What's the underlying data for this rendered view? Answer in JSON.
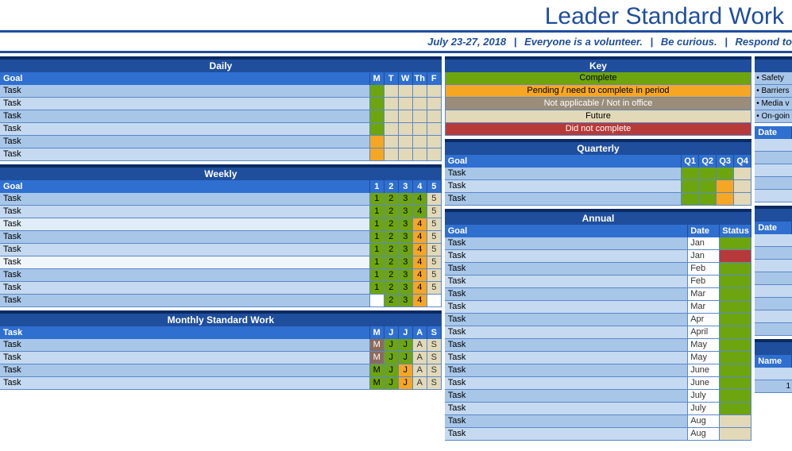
{
  "title": "Leader Standard Work",
  "subtitle": {
    "date": "July 23-27, 2018",
    "msg1": "Everyone is a volunteer.",
    "msg2": "Be curious.",
    "msg3": "Respond to"
  },
  "daily": {
    "title": "Daily",
    "goal_label": "Goal",
    "cols": [
      "M",
      "T",
      "W",
      "Th",
      "F"
    ],
    "rows": [
      {
        "label": "Task",
        "cells": [
          "c-green",
          "c-tan",
          "c-tan",
          "c-tan",
          "c-tan"
        ]
      },
      {
        "label": "Task",
        "cells": [
          "c-green",
          "c-tan",
          "c-tan",
          "c-tan",
          "c-tan"
        ]
      },
      {
        "label": "Task",
        "cells": [
          "c-green",
          "c-tan",
          "c-tan",
          "c-tan",
          "c-tan"
        ]
      },
      {
        "label": "Task",
        "cells": [
          "c-green",
          "c-tan",
          "c-tan",
          "c-tan",
          "c-tan"
        ]
      },
      {
        "label": "Task",
        "cells": [
          "c-orange",
          "c-tan",
          "c-tan",
          "c-tan",
          "c-tan"
        ]
      },
      {
        "label": "Task",
        "cells": [
          "c-orange",
          "c-tan",
          "c-tan",
          "c-tan",
          "c-tan"
        ]
      }
    ]
  },
  "weekly": {
    "title": "Weekly",
    "goal_label": "Goal",
    "cols": [
      "1",
      "2",
      "3",
      "4",
      "5"
    ],
    "rows": [
      {
        "label": "Task",
        "bg": "lbl",
        "cells": [
          [
            "1",
            "c-green"
          ],
          [
            "2",
            "c-green"
          ],
          [
            "3",
            "c-green"
          ],
          [
            "4",
            "c-green"
          ],
          [
            "5",
            "c-tan"
          ]
        ]
      },
      {
        "label": "Task",
        "bg": "lbl alt",
        "cells": [
          [
            "1",
            "c-green"
          ],
          [
            "2",
            "c-green"
          ],
          [
            "3",
            "c-green"
          ],
          [
            "4",
            "c-green"
          ],
          [
            "5",
            "c-tan"
          ]
        ]
      },
      {
        "label": "Task",
        "bg": "lbl lt",
        "cells": [
          [
            "1",
            "c-green"
          ],
          [
            "2",
            "c-green"
          ],
          [
            "3",
            "c-green"
          ],
          [
            "4",
            "c-orange"
          ],
          [
            "5",
            "c-tan"
          ]
        ]
      },
      {
        "label": "Task",
        "bg": "lbl",
        "cells": [
          [
            "1",
            "c-green"
          ],
          [
            "2",
            "c-green"
          ],
          [
            "3",
            "c-green"
          ],
          [
            "4",
            "c-orange"
          ],
          [
            "5",
            "c-tan"
          ]
        ]
      },
      {
        "label": "Task",
        "bg": "lbl alt",
        "cells": [
          [
            "1",
            "c-green"
          ],
          [
            "2",
            "c-green"
          ],
          [
            "3",
            "c-green"
          ],
          [
            "4",
            "c-orange"
          ],
          [
            "5",
            "c-tan"
          ]
        ]
      },
      {
        "label": "Task",
        "bg": "lbl vlt",
        "cells": [
          [
            "1",
            "c-green"
          ],
          [
            "2",
            "c-green"
          ],
          [
            "3",
            "c-green"
          ],
          [
            "4",
            "c-orange"
          ],
          [
            "5",
            "c-tan"
          ]
        ]
      },
      {
        "label": "Task",
        "bg": "lbl",
        "cells": [
          [
            "1",
            "c-green"
          ],
          [
            "2",
            "c-green"
          ],
          [
            "3",
            "c-green"
          ],
          [
            "4",
            "c-orange"
          ],
          [
            "5",
            "c-tan"
          ]
        ]
      },
      {
        "label": "Task",
        "bg": "lbl alt",
        "cells": [
          [
            "1",
            "c-green"
          ],
          [
            "2",
            "c-green"
          ],
          [
            "3",
            "c-green"
          ],
          [
            "4",
            "c-orange"
          ],
          [
            "5",
            "c-tan"
          ]
        ]
      },
      {
        "label": "Task",
        "bg": "lbl",
        "cells": [
          [
            "",
            "c-white"
          ],
          [
            "2",
            "c-green"
          ],
          [
            "3",
            "c-green"
          ],
          [
            "4",
            "c-orange"
          ],
          [
            "",
            "c-white"
          ]
        ]
      }
    ]
  },
  "monthly": {
    "title": "Monthly Standard Work",
    "task_label": "Task",
    "cols": [
      "M",
      "J",
      "J",
      "A",
      "S"
    ],
    "rows": [
      {
        "label": "Task",
        "cells": [
          [
            "M",
            "c-brown"
          ],
          [
            "J",
            "c-green"
          ],
          [
            "J",
            "c-green"
          ],
          [
            "A",
            "c-tan"
          ],
          [
            "S",
            "c-tan"
          ]
        ]
      },
      {
        "label": "Task",
        "cells": [
          [
            "M",
            "c-brown"
          ],
          [
            "J",
            "c-green"
          ],
          [
            "J",
            "c-green"
          ],
          [
            "A",
            "c-tan"
          ],
          [
            "S",
            "c-tan"
          ]
        ]
      },
      {
        "label": "Task",
        "cells": [
          [
            "M",
            "c-green"
          ],
          [
            "J",
            "c-green"
          ],
          [
            "J",
            "c-orange"
          ],
          [
            "A",
            "c-tan"
          ],
          [
            "S",
            "c-tan"
          ]
        ]
      },
      {
        "label": "Task",
        "cells": [
          [
            "M",
            "c-green"
          ],
          [
            "J",
            "c-green"
          ],
          [
            "J",
            "c-orange"
          ],
          [
            "A",
            "c-tan"
          ],
          [
            "S",
            "c-tan"
          ]
        ]
      }
    ]
  },
  "key": {
    "title": "Key",
    "items": [
      {
        "label": "Complete",
        "class": "c-green"
      },
      {
        "label": "Pending / need to complete in period",
        "class": "c-orange"
      },
      {
        "label": "Not applicable / Not in office",
        "class": "c-grey"
      },
      {
        "label": "Future",
        "class": "c-tan"
      },
      {
        "label": "Did not complete",
        "class": "c-red"
      }
    ]
  },
  "quarterly": {
    "title": "Quarterly",
    "goal_label": "Goal",
    "cols": [
      "Q1",
      "Q2",
      "Q3",
      "Q4"
    ],
    "rows": [
      {
        "label": "Task",
        "cells": [
          "c-green",
          "c-green",
          "c-green",
          "c-tan"
        ]
      },
      {
        "label": "Task",
        "cells": [
          "c-green",
          "c-green",
          "c-orange",
          "c-tan"
        ]
      },
      {
        "label": "Task",
        "cells": [
          "c-green",
          "c-green",
          "c-orange",
          "c-tan"
        ]
      }
    ]
  },
  "annual": {
    "title": "Annual",
    "goal_label": "Goal",
    "date_label": "Date",
    "status_label": "Status",
    "rows": [
      {
        "label": "Task",
        "date": "Jan",
        "status": "c-green"
      },
      {
        "label": "Task",
        "date": "Jan",
        "status": "c-red"
      },
      {
        "label": "Task",
        "date": "Feb",
        "status": "c-green"
      },
      {
        "label": "Task",
        "date": "Feb",
        "status": "c-green"
      },
      {
        "label": "Task",
        "date": "Mar",
        "status": "c-green"
      },
      {
        "label": "Task",
        "date": "Mar",
        "status": "c-green"
      },
      {
        "label": "Task",
        "date": "Apr",
        "status": "c-green"
      },
      {
        "label": "Task",
        "date": "April",
        "status": "c-green"
      },
      {
        "label": "Task",
        "date": "May",
        "status": "c-green"
      },
      {
        "label": "Task",
        "date": "May",
        "status": "c-green"
      },
      {
        "label": "Task",
        "date": "June",
        "status": "c-green"
      },
      {
        "label": "Task",
        "date": "June",
        "status": "c-green"
      },
      {
        "label": "Task",
        "date": "July",
        "status": "c-green"
      },
      {
        "label": "Task",
        "date": "July",
        "status": "c-green"
      },
      {
        "label": "Task",
        "date": "Aug",
        "status": "c-tan"
      },
      {
        "label": "Task",
        "date": "Aug",
        "status": "c-tan"
      }
    ]
  },
  "side": {
    "notes": [
      "• Safety",
      "• Barriers",
      "• Media v",
      "• On-goin"
    ],
    "date_label": "Date",
    "date_label2": "Date",
    "name_label": "Name",
    "one": "1"
  }
}
